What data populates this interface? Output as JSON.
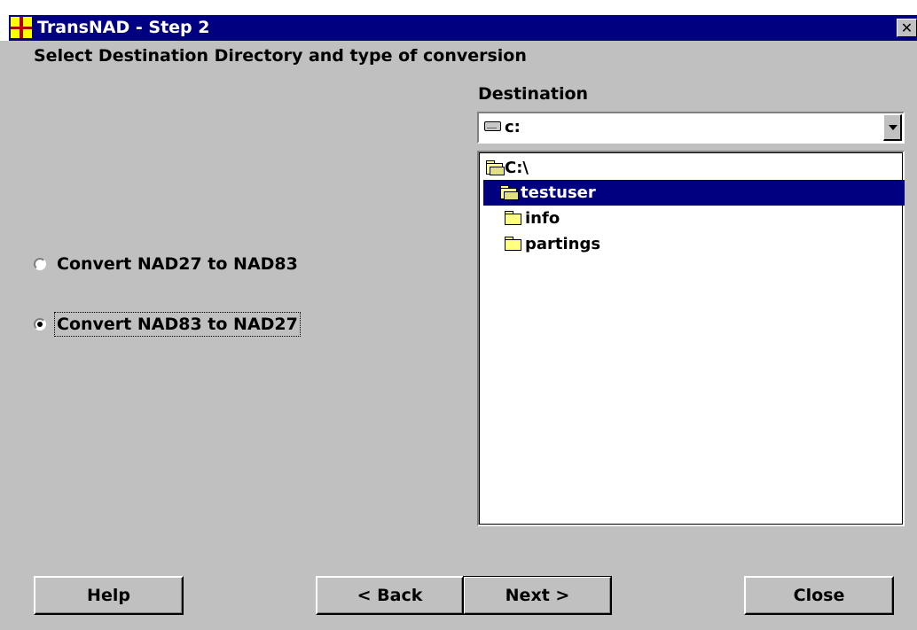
{
  "window": {
    "title": "TransNAD - Step 2",
    "close_glyph": "✕"
  },
  "subtitle": "Select Destination Directory and type of conversion",
  "destination": {
    "label": "Destination",
    "drive_icon": "drive-icon",
    "drive_value": "c:",
    "tree": [
      {
        "label": "C:\\",
        "icon": "open-folder-icon",
        "selected": false
      },
      {
        "label": "testuser",
        "icon": "open-folder-icon",
        "selected": true
      },
      {
        "label": "info",
        "icon": "folder-icon",
        "selected": false
      },
      {
        "label": "partings",
        "icon": "folder-icon",
        "selected": false
      }
    ]
  },
  "conversion": {
    "options": [
      {
        "label": "Convert NAD27 to NAD83",
        "checked": false
      },
      {
        "label": "Convert NAD83 to NAD27",
        "checked": true
      }
    ]
  },
  "buttons": {
    "help": "Help",
    "back": "< Back",
    "next": "Next >",
    "close": "Close"
  },
  "colors": {
    "titlebar": "#000080",
    "face": "#c0c0c0",
    "selection": "#000080"
  }
}
